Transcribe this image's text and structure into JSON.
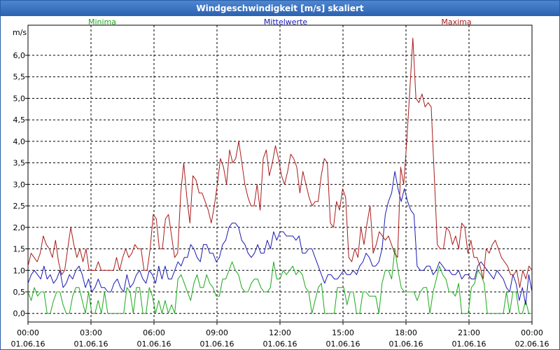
{
  "window": {
    "title": "Windgeschwindigkeit [m/s] skaliert"
  },
  "chart_data": {
    "type": "line",
    "ylabel": "m/s",
    "ylim": [
      -0.2,
      6.7
    ],
    "y_ticks": [
      "0,0",
      "0,5",
      "1,0",
      "1,5",
      "2,0",
      "2,5",
      "3,0",
      "3,5",
      "4,0",
      "4,5",
      "5,0",
      "5,5",
      "6,0"
    ],
    "x_range_hours": [
      0,
      24
    ],
    "x_ticks": [
      {
        "time": "00:00",
        "date": "01.06.16"
      },
      {
        "time": "03:00",
        "date": "01.06.16"
      },
      {
        "time": "06:00",
        "date": "01.06.16"
      },
      {
        "time": "09:00",
        "date": "01.06.16"
      },
      {
        "time": "12:00",
        "date": "01.06.16"
      },
      {
        "time": "15:00",
        "date": "01.06.16"
      },
      {
        "time": "18:00",
        "date": "01.06.16"
      },
      {
        "time": "21:00",
        "date": "01.06.16"
      },
      {
        "time": "00:00",
        "date": "02.06.16"
      }
    ],
    "grid": true,
    "series": [
      {
        "name": "Minima",
        "color": "#1aa81a",
        "values": [
          0.5,
          0.3,
          0.6,
          0.4,
          0.5,
          0.5,
          0.0,
          0.0,
          0.3,
          0.5,
          0.5,
          0.2,
          0.0,
          0.0,
          0.4,
          0.6,
          0.6,
          0.3,
          0.0,
          0.5,
          0.0,
          0.0,
          0.3,
          0.0,
          0.5,
          0.0,
          0.0,
          0.0,
          0.0,
          0.0,
          0.0,
          0.6,
          0.5,
          0.0,
          0.6,
          0.6,
          0.0,
          0.0,
          0.6,
          0.4,
          0.0,
          0.3,
          0.0,
          0.3,
          0.0,
          0.2,
          0.0,
          0.8,
          0.9,
          0.7,
          0.5,
          0.3,
          0.7,
          0.9,
          0.6,
          0.6,
          0.9,
          0.7,
          0.6,
          0.4,
          0.4,
          0.8,
          0.8,
          1.0,
          1.2,
          1.0,
          0.9,
          0.6,
          0.5,
          0.5,
          0.7,
          0.8,
          0.8,
          0.6,
          0.5,
          0.5,
          0.6,
          1.2,
          0.8,
          0.8,
          1.0,
          0.9,
          1.0,
          1.1,
          0.9,
          1.0,
          0.9,
          0.6,
          0.5,
          0.0,
          0.3,
          0.6,
          0.7,
          0.0,
          0.0,
          0.0,
          0.0,
          0.6,
          0.6,
          0.6,
          0.2,
          0.5,
          0.5,
          0.0,
          0.0,
          0.5,
          0.5,
          0.4,
          0.4,
          0.4,
          0.0,
          0.7,
          1.0,
          1.0,
          0.8,
          1.5,
          1.0,
          0.6,
          0.5,
          0.5,
          0.5,
          0.5,
          0.3,
          0.5,
          0.6,
          0.6,
          0.0,
          0.5,
          0.8,
          1.1,
          0.9,
          0.8,
          0.5,
          0.5,
          0.4,
          0.7,
          0.0,
          0.0,
          0.0,
          0.6,
          0.7,
          1.0,
          0.9,
          0.7,
          0.0,
          0.0,
          0.0,
          0.0,
          0.0,
          0.0,
          0.5,
          0.0,
          0.5,
          0.5,
          0.0,
          0.0,
          0.3,
          0.0,
          0.0
        ]
      },
      {
        "name": "Mittelwerte",
        "color": "#1a1ab4",
        "values": [
          0.7,
          0.9,
          1.0,
          0.9,
          0.8,
          1.1,
          0.8,
          0.9,
          0.7,
          0.8,
          1.0,
          0.6,
          0.7,
          0.9,
          0.8,
          1.0,
          1.1,
          0.9,
          0.6,
          0.8,
          0.5,
          0.6,
          0.8,
          0.6,
          0.6,
          0.5,
          0.5,
          0.7,
          0.8,
          0.6,
          0.5,
          0.9,
          0.6,
          0.7,
          0.9,
          1.0,
          0.8,
          0.7,
          1.0,
          0.9,
          0.7,
          1.1,
          0.8,
          1.1,
          0.8,
          0.8,
          1.0,
          1.2,
          1.1,
          1.3,
          1.3,
          1.6,
          1.5,
          1.3,
          1.2,
          1.6,
          1.6,
          1.4,
          1.4,
          1.2,
          1.3,
          1.6,
          1.7,
          2.0,
          2.1,
          2.1,
          2.0,
          1.7,
          1.6,
          1.4,
          1.3,
          1.4,
          1.6,
          1.4,
          1.4,
          1.7,
          1.5,
          1.9,
          1.7,
          1.9,
          1.9,
          1.8,
          1.8,
          1.8,
          1.7,
          1.8,
          1.4,
          1.4,
          1.5,
          1.5,
          1.3,
          1.1,
          0.9,
          0.7,
          0.9,
          0.9,
          0.8,
          0.8,
          0.9,
          1.0,
          0.9,
          0.9,
          1.0,
          0.9,
          1.1,
          1.2,
          1.4,
          1.3,
          1.1,
          1.1,
          1.2,
          1.5,
          2.3,
          2.6,
          2.8,
          3.3,
          2.9,
          2.6,
          2.9,
          2.6,
          2.4,
          2.3,
          1.1,
          1.0,
          1.0,
          1.1,
          1.1,
          0.9,
          1.0,
          1.2,
          1.1,
          1.0,
          1.0,
          0.9,
          0.9,
          1.0,
          0.8,
          0.9,
          0.9,
          0.8,
          0.8,
          1.1,
          1.2,
          1.1,
          1.0,
          0.9,
          0.8,
          1.0,
          0.9,
          0.8,
          0.6,
          0.5,
          0.9,
          0.7,
          0.3,
          0.6,
          0.2,
          0.9,
          0.5
        ]
      },
      {
        "name": "Maxima",
        "color": "#aa1a1a",
        "values": [
          1.1,
          1.4,
          1.3,
          1.2,
          1.4,
          1.8,
          1.6,
          1.5,
          1.3,
          1.7,
          1.2,
          0.9,
          1.0,
          1.5,
          2.0,
          1.6,
          1.3,
          1.5,
          1.2,
          1.5,
          1.0,
          1.0,
          1.0,
          1.2,
          1.0,
          1.0,
          1.0,
          1.0,
          1.0,
          1.3,
          1.0,
          1.3,
          1.5,
          1.3,
          1.4,
          1.6,
          1.5,
          1.5,
          1.0,
          1.0,
          1.5,
          2.3,
          2.2,
          1.5,
          1.5,
          2.2,
          2.3,
          1.8,
          1.3,
          1.4,
          2.8,
          3.5,
          2.7,
          2.1,
          3.2,
          3.1,
          2.8,
          2.8,
          2.6,
          2.4,
          2.1,
          2.5,
          3.0,
          3.6,
          3.4,
          3.0,
          3.8,
          3.5,
          3.6,
          4.0,
          3.5,
          3.0,
          2.7,
          2.5,
          2.5,
          3.0,
          2.4,
          3.6,
          3.8,
          3.2,
          3.5,
          3.9,
          3.6,
          3.2,
          3.0,
          3.3,
          3.7,
          3.6,
          3.4,
          2.8,
          3.3,
          3.0,
          2.7,
          2.5,
          2.6,
          2.6,
          3.2,
          3.6,
          3.5,
          2.1,
          2.0,
          2.6,
          2.4,
          2.9,
          2.7,
          1.3,
          1.2,
          1.5,
          1.3,
          2.0,
          1.6,
          2.1,
          2.5,
          1.4,
          1.6,
          1.9,
          1.8,
          1.7,
          1.8,
          1.6,
          1.4,
          1.3,
          3.4,
          3.0,
          4.0,
          5.2,
          6.4,
          5.0,
          4.9,
          5.1,
          4.8,
          4.9,
          4.8,
          3.2,
          1.6,
          1.5,
          1.5,
          2.0,
          1.9,
          1.6,
          1.8,
          1.5,
          2.1,
          2.0,
          1.4,
          1.7,
          1.3,
          1.3,
          1.1,
          0.8,
          1.5,
          1.4,
          1.6,
          1.7,
          1.5,
          1.3,
          1.2,
          1.1,
          0.9,
          0.9,
          1.0,
          0.6,
          1.0,
          0.8,
          1.1,
          1.0
        ]
      }
    ]
  }
}
